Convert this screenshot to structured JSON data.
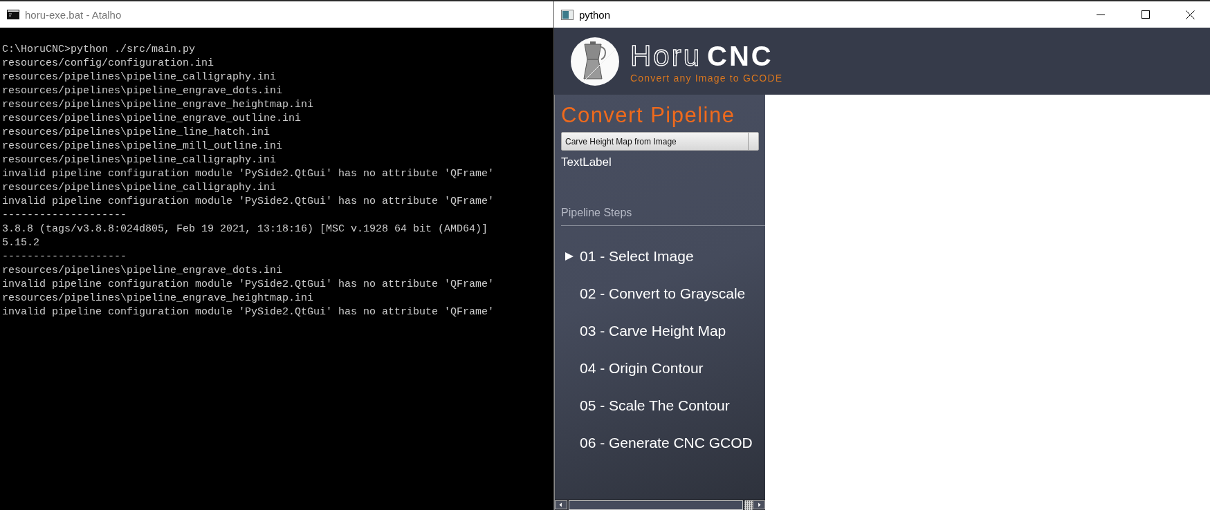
{
  "console_window": {
    "title": "horu-exe.bat - Atalho",
    "lines": [
      "C:\\HoruCNC>python ./src/main.py",
      "resources/config/configuration.ini",
      "resources/pipelines\\pipeline_calligraphy.ini",
      "resources/pipelines\\pipeline_engrave_dots.ini",
      "resources/pipelines\\pipeline_engrave_heightmap.ini",
      "resources/pipelines\\pipeline_engrave_outline.ini",
      "resources/pipelines\\pipeline_line_hatch.ini",
      "resources/pipelines\\pipeline_mill_outline.ini",
      "resources/pipelines\\pipeline_calligraphy.ini",
      "invalid pipeline configuration module 'PySide2.QtGui' has no attribute 'QFrame'",
      "resources/pipelines\\pipeline_calligraphy.ini",
      "invalid pipeline configuration module 'PySide2.QtGui' has no attribute 'QFrame'",
      "--------------------",
      "3.8.8 (tags/v3.8.8:024d805, Feb 19 2021, 13:18:16) [MSC v.1928 64 bit (AMD64)]",
      "5.15.2",
      "--------------------",
      "resources/pipelines\\pipeline_engrave_dots.ini",
      "invalid pipeline configuration module 'PySide2.QtGui' has no attribute 'QFrame'",
      "resources/pipelines\\pipeline_engrave_heightmap.ini",
      "invalid pipeline configuration module 'PySide2.QtGui' has no attribute 'QFrame'"
    ]
  },
  "app_window": {
    "title": "python",
    "header": {
      "brand_light": "Horu",
      "brand_bold": "CNC",
      "tagline": "Convert any Image to GCODE"
    },
    "sidebar": {
      "heading": "Convert Pipeline",
      "pipeline_select": {
        "value": "Carve Height Map from Image"
      },
      "label": "TextLabel",
      "section_title": "Pipeline Steps",
      "steps": [
        {
          "label": "01 - Select Image",
          "selected": true
        },
        {
          "label": "02 - Convert to Grayscale",
          "selected": false
        },
        {
          "label": "03 - Carve Height Map",
          "selected": false
        },
        {
          "label": "04 - Origin Contour",
          "selected": false
        },
        {
          "label": "05 - Scale The Contour",
          "selected": false
        },
        {
          "label": "06 - Generate CNC GCOD",
          "selected": false
        }
      ]
    }
  }
}
